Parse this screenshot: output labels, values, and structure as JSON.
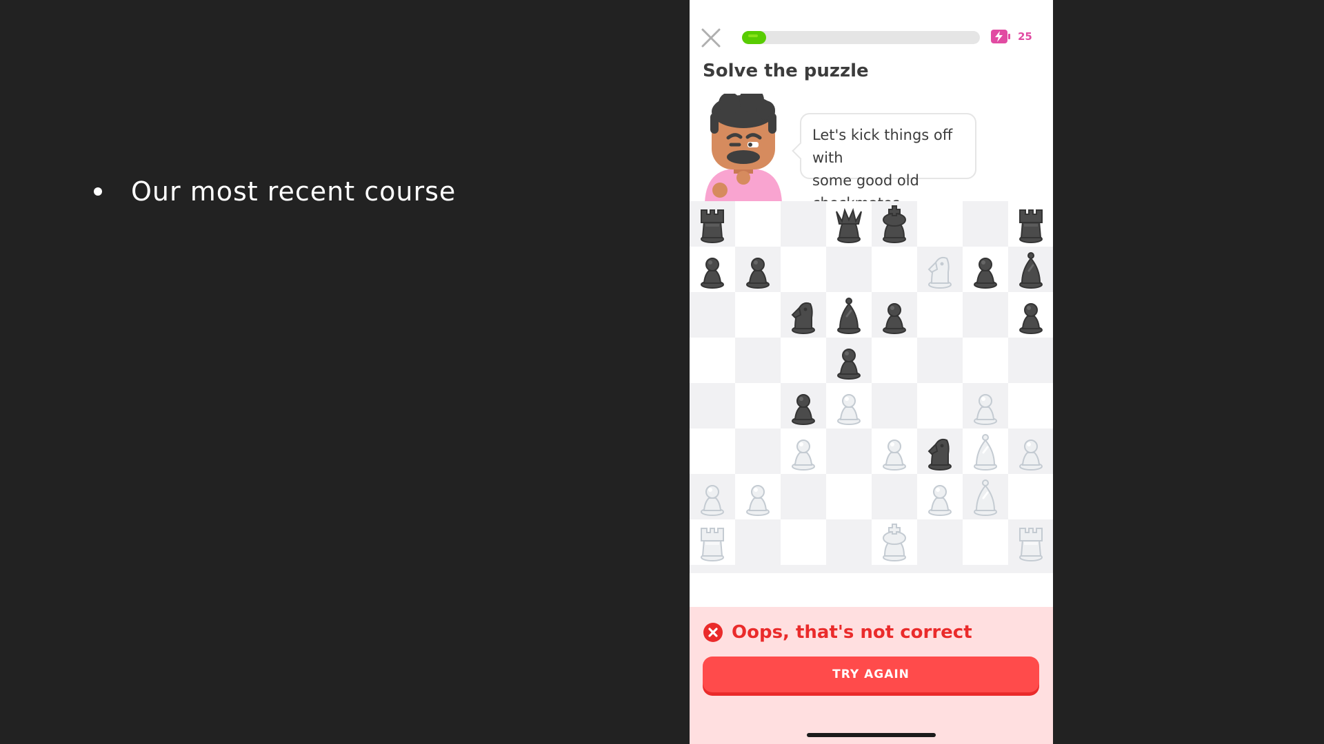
{
  "slide": {
    "bullets": [
      "Our most recent course"
    ]
  },
  "lesson": {
    "progress_fraction": 0.1,
    "energy_count": "25",
    "title": "Solve the puzzle",
    "speech_line1": "Let's kick things off with",
    "speech_line2": "some good old checkmates.",
    "icons": {
      "close": "close-icon",
      "energy": "battery-bolt-icon",
      "error": "error-x-icon"
    },
    "colors": {
      "progress": "#58cc02",
      "energy": "#e14ba2",
      "error": "#ea2b2b",
      "button": "#ff4b4b",
      "feedback_bg": "#ffdfe0"
    }
  },
  "board": {
    "rows": [
      [
        "bR",
        "",
        "",
        "bQ",
        "bK",
        "",
        "",
        "bR"
      ],
      [
        "bP",
        "bP",
        "",
        "",
        "",
        "wN",
        "bP",
        "bB"
      ],
      [
        "",
        "",
        "bN",
        "bB",
        "bP",
        "",
        "",
        "bP"
      ],
      [
        "",
        "",
        "",
        "bP",
        "",
        "",
        "",
        ""
      ],
      [
        "",
        "",
        "bP",
        "wP",
        "",
        "",
        "wP",
        ""
      ],
      [
        "",
        "",
        "wP",
        "",
        "wP",
        "bN",
        "wB",
        "wP"
      ],
      [
        "wP",
        "wP",
        "",
        "",
        "",
        "wP",
        "wB",
        ""
      ],
      [
        "wR",
        "",
        "",
        "",
        "wK",
        "",
        "",
        "wR"
      ]
    ]
  },
  "feedback": {
    "message": "Oops, that's not correct",
    "button_label": "TRY AGAIN"
  }
}
